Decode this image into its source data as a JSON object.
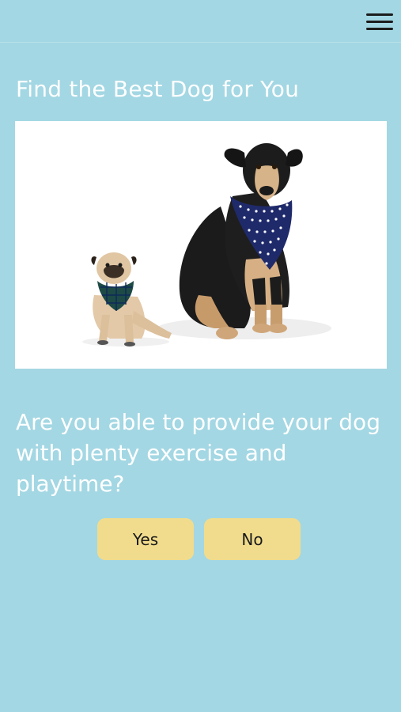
{
  "header": {
    "menu_icon": "hamburger-menu-icon"
  },
  "main": {
    "title": "Find the Best Dog for You",
    "image": {
      "description_icon": "two-dogs-with-bandanas-image"
    },
    "question": "Are you able to provide your dog with plenty exercise and playtime?",
    "buttons": {
      "yes_label": "Yes",
      "no_label": "No"
    }
  },
  "colors": {
    "background": "#a3d7e3",
    "button": "#f1dc8d",
    "text": "#ffffff"
  }
}
